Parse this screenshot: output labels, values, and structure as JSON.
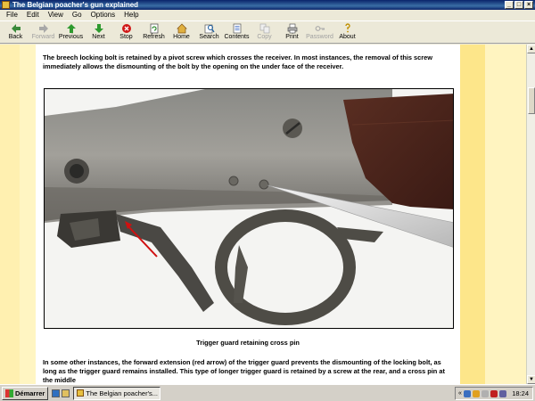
{
  "window": {
    "title": "The Belgian poacher's gun explained",
    "controls": [
      "_",
      "□",
      "×"
    ]
  },
  "menu": [
    "File",
    "Edit",
    "View",
    "Go",
    "Options",
    "Help"
  ],
  "toolbar": [
    {
      "label": "Back",
      "icon": "back-arrow-icon",
      "enabled": true
    },
    {
      "label": "Forward",
      "icon": "forward-arrow-icon",
      "enabled": false
    },
    {
      "label": "Previous",
      "icon": "up-arrow-icon",
      "enabled": true
    },
    {
      "label": "Next",
      "icon": "down-arrow-icon",
      "enabled": true
    },
    {
      "label": "Stop",
      "icon": "stop-icon",
      "enabled": true
    },
    {
      "label": "Refresh",
      "icon": "refresh-icon",
      "enabled": true
    },
    {
      "label": "Home",
      "icon": "home-icon",
      "enabled": true
    },
    {
      "label": "Search",
      "icon": "search-icon",
      "enabled": true
    },
    {
      "label": "Contents",
      "icon": "contents-icon",
      "enabled": true
    },
    {
      "label": "Copy",
      "icon": "copy-icon",
      "enabled": false
    },
    {
      "label": "Print",
      "icon": "print-icon",
      "enabled": true
    },
    {
      "label": "Password",
      "icon": "key-icon",
      "enabled": false
    },
    {
      "label": "About",
      "icon": "about-icon",
      "enabled": true
    }
  ],
  "content": {
    "paragraph1": "The breech locking bolt is retained by a pivot screw which crosses the receiver. In most instances, the removal of this screw immediately allows the dismounting of the bolt by the opening on the under face of the receiver.",
    "caption": "Trigger guard retaining cross pin",
    "paragraph2": "In some other instances, the forward extension (red arrow) of the trigger guard prevents the dismounting of the locking bolt, as long as the trigger guard remains installed. This type of longer trigger guard is retained by a screw at the rear, and a cross pin at the middle"
  },
  "colors": {
    "page_bg": "#ffffff",
    "band_yellow": "#fde68a",
    "title_blue": "#0a246a",
    "arrow_red": "#d01010"
  },
  "taskbar": {
    "start_label": "Démarrer",
    "task_label": "The Belgian poacher's...",
    "tray_prefix": "«",
    "clock": "18:24"
  }
}
